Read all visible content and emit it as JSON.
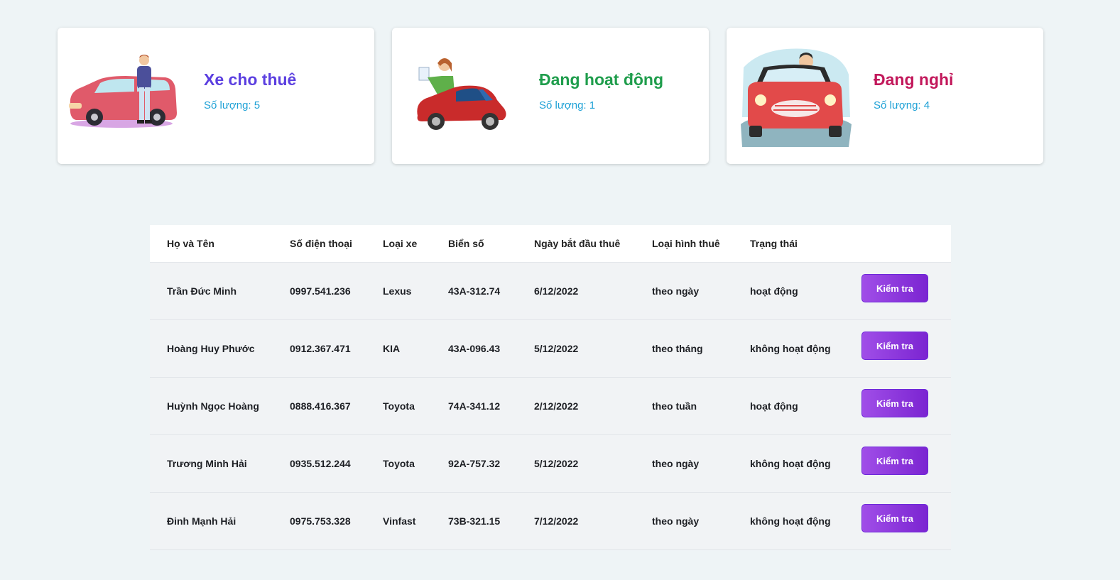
{
  "summary_cards": [
    {
      "title": "Xe cho thuê",
      "count_text": "Số lượng: 5",
      "title_color": "#5b3fe0",
      "illustration": "man-with-red-car-icon"
    },
    {
      "title": "Đang hoạt động",
      "count_text": "Số lượng: 1",
      "title_color": "#1f9d4c",
      "illustration": "girl-driving-red-car-icon"
    },
    {
      "title": "Đang nghỉ",
      "count_text": "Số lượng: 4",
      "title_color": "#c2185b",
      "illustration": "man-driving-convertible-icon"
    }
  ],
  "table": {
    "headers": [
      "Họ và Tên",
      "Số điện thoại",
      "Loại xe",
      "Biển số",
      "Ngày bắt đầu thuê",
      "Loại hình thuê",
      "Trạng thái"
    ],
    "rows": [
      {
        "name": "Trần Đức Minh",
        "phone": "0997.541.236",
        "car_type": "Lexus",
        "plate": "43A-312.74",
        "start_date": "6/12/2022",
        "rental_type": "theo ngày",
        "status": "hoạt động",
        "action": "Kiểm tra"
      },
      {
        "name": "Hoàng Huy Phước",
        "phone": "0912.367.471",
        "car_type": "KIA",
        "plate": "43A-096.43",
        "start_date": "5/12/2022",
        "rental_type": "theo tháng",
        "status": "không hoạt động",
        "action": "Kiểm tra"
      },
      {
        "name": "Huỳnh Ngọc Hoàng",
        "phone": "0888.416.367",
        "car_type": "Toyota",
        "plate": "74A-341.12",
        "start_date": "2/12/2022",
        "rental_type": "theo tuần",
        "status": "hoạt động",
        "action": "Kiểm tra"
      },
      {
        "name": "Trương Minh Hải",
        "phone": "0935.512.244",
        "car_type": "Toyota",
        "plate": "92A-757.32",
        "start_date": "5/12/2022",
        "rental_type": "theo ngày",
        "status": "không hoạt động",
        "action": "Kiểm tra"
      },
      {
        "name": "Đinh Mạnh Hải",
        "phone": "0975.753.328",
        "car_type": "Vinfast",
        "plate": "73B-321.15",
        "start_date": "7/12/2022",
        "rental_type": "theo ngày",
        "status": "không hoạt động",
        "action": "Kiểm tra"
      }
    ]
  },
  "colors": {
    "button_gradient_start": "#a04ee8",
    "button_gradient_end": "#7b24d1",
    "count_text": "#1ea1d6"
  }
}
